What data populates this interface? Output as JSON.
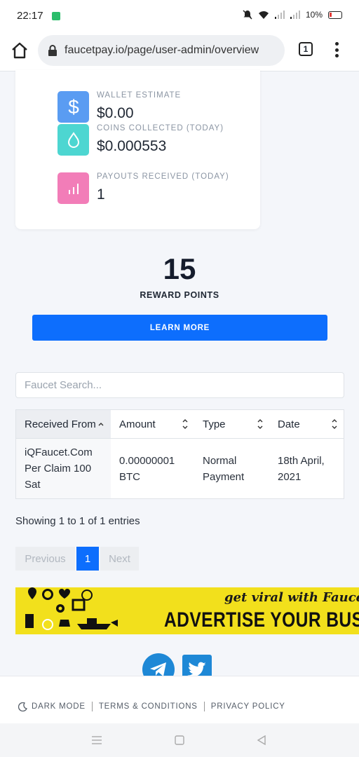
{
  "status_bar": {
    "time": "22:17",
    "battery": "10%"
  },
  "browser": {
    "url": "faucetpay.io/page/user-admin/overview",
    "tab_count": "1"
  },
  "stats": [
    {
      "label": "WALLET ESTIMATE",
      "value": "$0.00",
      "icon": "dollar-icon",
      "color": "#5a9cf2"
    },
    {
      "label": "COINS COLLECTED (TODAY)",
      "value": "$0.000553",
      "icon": "drop-icon",
      "color": "#4dd6d1"
    },
    {
      "label": "PAYOUTS RECEIVED (TODAY)",
      "value": "1",
      "icon": "bar-chart-icon",
      "color": "#f27db8"
    }
  ],
  "reward": {
    "points": "15",
    "label": "REWARD POINTS",
    "button": "LEARN MORE"
  },
  "search": {
    "placeholder": "Faucet Search..."
  },
  "table": {
    "columns": [
      "Received From",
      "Amount",
      "Type",
      "Date"
    ],
    "rows": [
      {
        "from": "iQFaucet.Com Per Claim 100 Sat",
        "amount": "0.00000001 BTC",
        "type": "Normal Payment",
        "date": "18th April, 2021"
      }
    ]
  },
  "entries_info": "Showing 1 to 1 of 1 entries",
  "pagination": {
    "previous": "Previous",
    "current": "1",
    "next": "Next"
  },
  "ad": {
    "tagline": "get viral with FaucetPay",
    "headline": "ADVERTISE YOUR BUSINES"
  },
  "footer": {
    "dark_mode": "DARK MODE",
    "terms": "TERMS & CONDITIONS",
    "privacy": "PRIVACY POLICY"
  },
  "colors": {
    "primary": "#0d6efd",
    "social": "#1e88d6",
    "ad_background": "#f2e01c"
  }
}
